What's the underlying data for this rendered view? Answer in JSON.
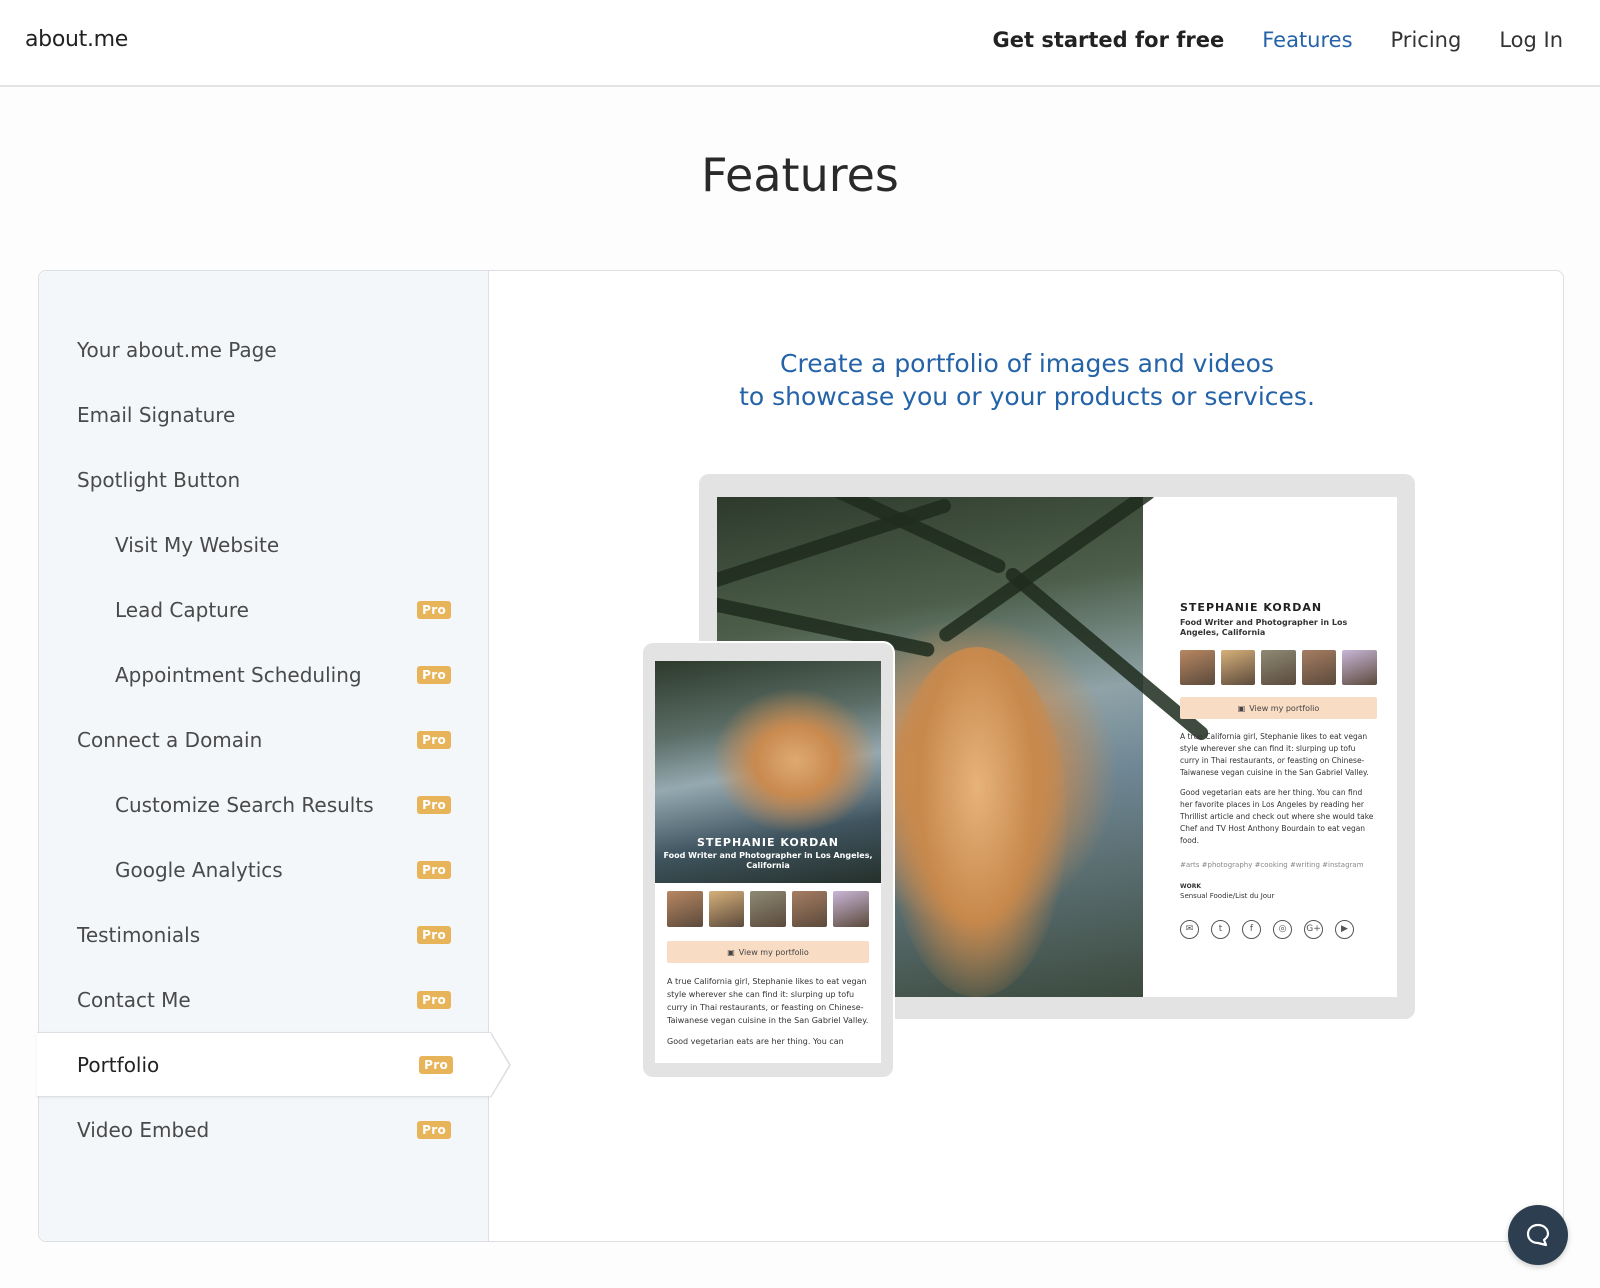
{
  "header": {
    "logo": "about.me",
    "nav": {
      "get_started": "Get started for free",
      "features": "Features",
      "pricing": "Pricing",
      "login": "Log In"
    }
  },
  "page_title": "Features",
  "sidebar": {
    "items": [
      {
        "label": "Your about.me Page",
        "sub": false,
        "pro": ""
      },
      {
        "label": "Email Signature",
        "sub": false,
        "pro": ""
      },
      {
        "label": "Spotlight Button",
        "sub": false,
        "pro": ""
      },
      {
        "label": "Visit My Website",
        "sub": true,
        "pro": ""
      },
      {
        "label": "Lead Capture",
        "sub": true,
        "pro": "Pro"
      },
      {
        "label": "Appointment Scheduling",
        "sub": true,
        "pro": "Pro"
      },
      {
        "label": "Connect a Domain",
        "sub": false,
        "pro": "Pro"
      },
      {
        "label": "Customize Search Results",
        "sub": true,
        "pro": "Pro"
      },
      {
        "label": "Google Analytics",
        "sub": true,
        "pro": "Pro"
      },
      {
        "label": "Testimonials",
        "sub": false,
        "pro": "Pro"
      },
      {
        "label": "Contact Me",
        "sub": false,
        "pro": "Pro"
      },
      {
        "label": "Portfolio",
        "sub": false,
        "pro": "Pro",
        "active": true
      },
      {
        "label": "Video Embed",
        "sub": false,
        "pro": "Pro"
      }
    ]
  },
  "content": {
    "tagline_line1": "Create a portfolio of images and videos",
    "tagline_line2": "to showcase you or your products or services."
  },
  "mockup": {
    "name": "STEPHANIE KORDAN",
    "role": "Food Writer and Photographer in Los Angeles, California",
    "portfolio_button": "View my portfolio",
    "bio1": "A true California girl, Stephanie likes to eat vegan style wherever she can find it: slurping up tofu curry in Thai restaurants, or feasting on Chinese-Taiwanese vegan cuisine in the San Gabriel Valley.",
    "bio2": "Good vegetarian eats are her thing. You can find her favorite places in Los Angeles by reading her Thrillist article and check out where she would take Chef and TV Host Anthony Bourdain to eat vegan food.",
    "bio2_tablet": "Good vegetarian eats are her thing. You can",
    "tags": "#arts  #photography  #cooking  #writing  #instagram",
    "work_label": "WORK",
    "work": "Sensual Foodie/List du Jour",
    "socials": [
      "email-icon",
      "twitter-icon",
      "facebook-icon",
      "instagram-icon",
      "google-plus-icon",
      "youtube-icon"
    ],
    "thumb_colors": [
      "#b88762",
      "#d7b07a",
      "#8d8a74",
      "#a67d62",
      "#c9b6d8"
    ]
  },
  "colors": {
    "accent": "#2463a8",
    "pro_badge": "#e7b45a",
    "sidebar_bg": "#f4f7fa",
    "portfolio_button": "#f9dcc4"
  }
}
